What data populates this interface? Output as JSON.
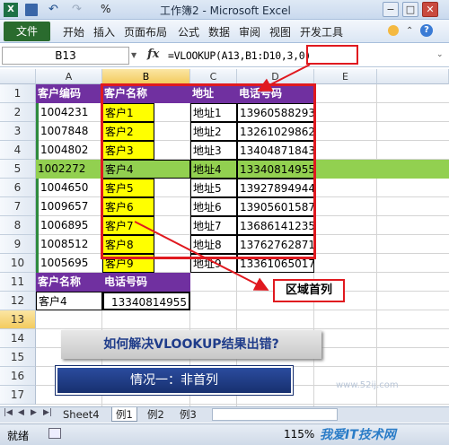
{
  "window": {
    "title": "工作簿2 - Microsoft Excel",
    "qa_icons": [
      "excel-logo-icon",
      "save-icon",
      "undo-icon",
      "redo-icon",
      "percent-icon"
    ],
    "percent": "%",
    "min": "−",
    "restore": "□",
    "close": "✕"
  },
  "ribbon": {
    "file": "文件",
    "tabs": [
      "开始",
      "插入",
      "页面布局",
      "公式",
      "数据",
      "审阅",
      "视图",
      "开发工具"
    ],
    "icons": [
      "help-icon"
    ]
  },
  "formula_bar": {
    "name_box": "B13",
    "fx": "fx",
    "formula": "=VLOOKUP(A13,B1:D10,3,0)"
  },
  "columns": [
    "A",
    "B",
    "C",
    "D",
    "E"
  ],
  "rows": [
    "1",
    "2",
    "3",
    "4",
    "5",
    "6",
    "7",
    "8",
    "9",
    "10",
    "11",
    "12",
    "13",
    "14",
    "15",
    "16",
    "17",
    "18",
    "19"
  ],
  "table": {
    "headers": [
      "客户编码",
      "客户名称",
      "地址",
      "电话号码"
    ],
    "data": [
      [
        "1004231",
        "客户1",
        "地址1",
        "13960588293"
      ],
      [
        "1007848",
        "客户2",
        "地址2",
        "13261029862"
      ],
      [
        "1004802",
        "客户3",
        "地址3",
        "13404871843"
      ],
      [
        "1002272",
        "客户4",
        "地址4",
        "13340814955"
      ],
      [
        "1004650",
        "客户5",
        "地址5",
        "13927894944"
      ],
      [
        "1009657",
        "客户6",
        "地址6",
        "13905601587"
      ],
      [
        "1006895",
        "客户7",
        "地址7",
        "13686141235"
      ],
      [
        "1008512",
        "客户8",
        "地址8",
        "13762762871"
      ],
      [
        "1005695",
        "客户9",
        "地址9",
        "13361065017"
      ]
    ]
  },
  "lookup": {
    "headers": [
      "客户名称",
      "电话号码"
    ],
    "key": "客户4",
    "result": "13340814955"
  },
  "callout": "区域首列",
  "banner_question": "如何解决VLOOKUP结果出错?",
  "banner_case": "情况一：非首列",
  "sheets": [
    "Sheet4",
    "例1",
    "例2",
    "例3"
  ],
  "status": {
    "ready": "就绪",
    "zoom": "115%",
    "watermark": "我爱IT技术网",
    "watermark_url": "www.52ij.com"
  },
  "colors": {
    "header_purple": "#7030a0",
    "highlight_yellow": "#ffff00",
    "highlight_green": "#92d050",
    "frame_red": "#e0191f",
    "file_tab_green": "#2a6b2e"
  }
}
